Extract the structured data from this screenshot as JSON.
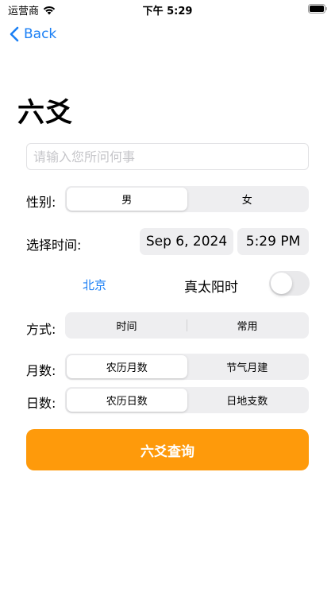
{
  "status_bar": {
    "carrier": "运营商",
    "time": "下午 5:29",
    "wifi_icon": "wifi-icon",
    "battery_icon": "battery-icon"
  },
  "nav": {
    "back_label": "Back",
    "back_icon": "chevron-left-icon"
  },
  "page": {
    "title": "六爻"
  },
  "question": {
    "placeholder": "请输入您所问何事",
    "value": ""
  },
  "gender": {
    "label": "性别:",
    "options": [
      "男",
      "女"
    ],
    "selected": "男"
  },
  "time_select": {
    "label": "选择时间:",
    "date": "Sep 6, 2024",
    "time": "5:29 PM"
  },
  "location": {
    "city": "北京",
    "solar_time_label": "真太阳时",
    "solar_time_enabled": false
  },
  "method": {
    "label": "方式:",
    "options": [
      "时间",
      "常用"
    ],
    "selected": ""
  },
  "month": {
    "label": "月数:",
    "options": [
      "农历月数",
      "节气月建"
    ],
    "selected": "农历月数"
  },
  "day": {
    "label": "日数:",
    "options": [
      "农历日数",
      "日地支数"
    ],
    "selected": "农历日数"
  },
  "submit": {
    "label": "六爻查询"
  },
  "colors": {
    "accent_blue": "#1a7ff5",
    "submit_orange": "#fe9a0b",
    "segment_bg": "#eeeef0"
  }
}
